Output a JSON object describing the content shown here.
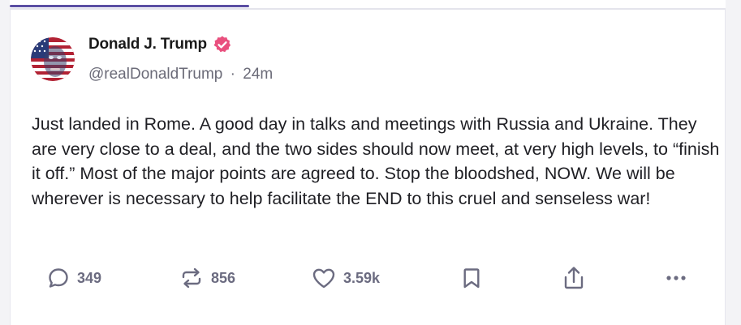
{
  "post": {
    "author_name": "Donald J. Trump",
    "handle": "@realDonaldTrump",
    "separator": "·",
    "time_ago": "24m",
    "text": "Just landed in Rome. A good day in talks and meetings with Russia and Ukraine. They are very close to a deal, and the two sides should now meet, at very high levels, to “finish it off.” Most of the major points are agreed to. Stop the bloodshed, NOW. We will be wherever is necessary to help facilitate the END to this cruel and senseless war!"
  },
  "actions": {
    "replies": "349",
    "reposts": "856",
    "likes": "3.59k"
  },
  "icons": {
    "verified": "verified-badge-icon",
    "reply": "comment-bubble-icon",
    "repost": "repost-arrows-icon",
    "like": "heart-icon",
    "bookmark": "bookmark-icon",
    "share": "share-upload-icon",
    "more": "more-dots-icon"
  },
  "colors": {
    "accent_tab": "#5b4ea3",
    "verified_badge": "#e9507e",
    "icon_gray": "#6b6b80",
    "text": "#1f1f24",
    "muted": "#6b6b78"
  }
}
